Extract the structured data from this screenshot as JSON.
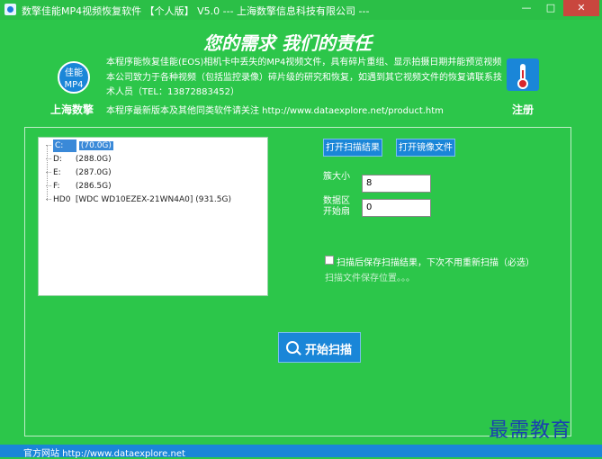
{
  "window": {
    "title": "数擎佳能MP4视频恢复软件  【个人版】  V5.0  ---  上海数擎信息科技有限公司  ---",
    "controls": {
      "minimize": "—",
      "maximize": "□",
      "close": "✕"
    }
  },
  "header": {
    "slogan": "您的需求   我们的责任",
    "logo_text": "佳能\nMP4",
    "company": "上海数擎",
    "description": "本程序能恢复佳能(EOS)相机卡中丢失的MP4视频文件，具有碎片重组、显示拍摄日期并能预览视频本公司致力于各种视频（包括监控录像）碎片级的研究和恢复，如遇到其它视频文件的恢复请联系技术人员（TEL：13872883452）",
    "note": "本程序最新版本及其他同类软件请关注 http://www.dataexplore.net/product.htm",
    "register_label": "注册",
    "register_icon": "thermometer-icon"
  },
  "drives": [
    {
      "name": "C:",
      "size": "(70.0G)",
      "selected": true
    },
    {
      "name": "D:",
      "size": "(288.0G)",
      "selected": false
    },
    {
      "name": "E:",
      "size": "(287.0G)",
      "selected": false
    },
    {
      "name": "F:",
      "size": "(286.5G)",
      "selected": false
    },
    {
      "name": "HD0",
      "size": "[WDC WD10EZEX-21WN4A0]  (931.5G)",
      "selected": false
    }
  ],
  "buttons": {
    "open_scan_result": "打开扫描结果",
    "open_mirror_file": "打开镜像文件",
    "start_scan": "开始扫描"
  },
  "fields": {
    "cluster_size_label": "簇大小",
    "cluster_size_value": "8",
    "data_start_label": "数据区开始扇",
    "data_start_value": "0"
  },
  "options": {
    "save_scan_result_label": "扫描后保存扫描结果，下次不用重新扫描（必选）",
    "save_scan_result_checked": false,
    "save_path_text": "扫描文件保存位置。。。"
  },
  "footer": {
    "website": "官方网站  http://www.dataexplore.net"
  },
  "watermark": "最需教育",
  "colors": {
    "background": "#2cc64a",
    "accent": "#1a86d8",
    "close": "#c9473e",
    "watermark": "#1a3fb0"
  }
}
